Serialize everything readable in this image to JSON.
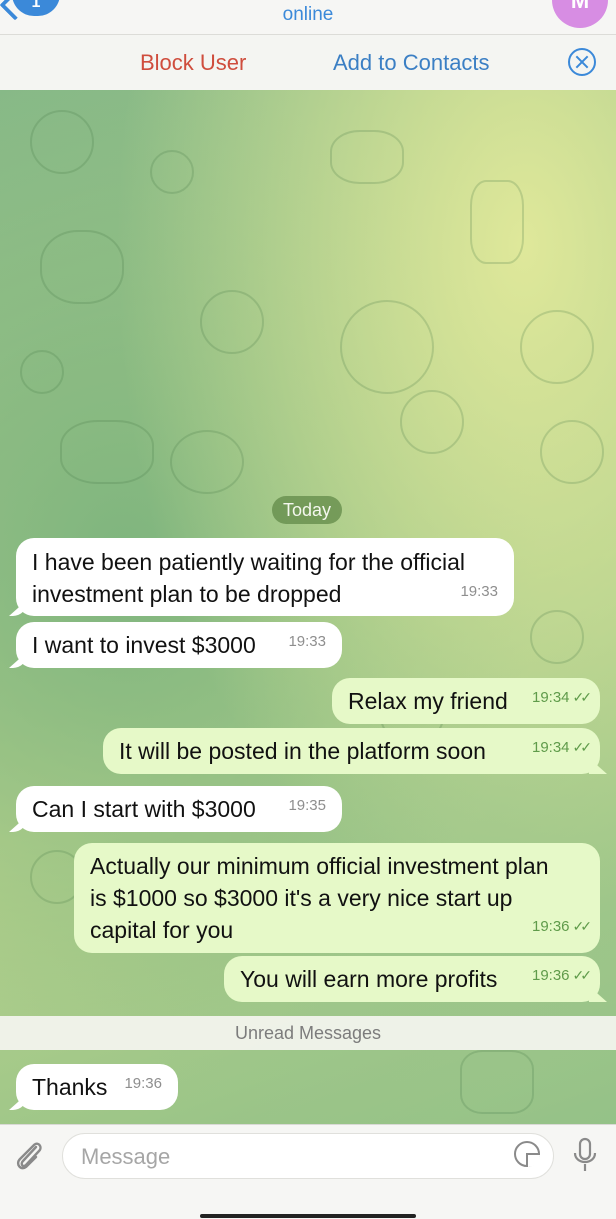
{
  "header": {
    "back_badge_count": "1",
    "status": "online",
    "avatar_initial": "M"
  },
  "action_bar": {
    "block_user": "Block User",
    "add_to_contacts": "Add to Contacts"
  },
  "chat": {
    "date_separator": "Today",
    "unread_label": "Unread Messages",
    "messages": [
      {
        "direction": "incoming",
        "text": "I have been patiently waiting for the official investment plan to be dropped",
        "time": "19:33"
      },
      {
        "direction": "incoming",
        "text": "I want to invest $3000",
        "time": "19:33"
      },
      {
        "direction": "outgoing",
        "text": "Relax my friend",
        "time": "19:34",
        "ticks": "✓✓"
      },
      {
        "direction": "outgoing",
        "text": "It will be posted in the platform soon",
        "time": "19:34",
        "ticks": "✓✓"
      },
      {
        "direction": "incoming",
        "text": "Can I start with $3000",
        "time": "19:35"
      },
      {
        "direction": "outgoing",
        "text": "Actually our minimum official investment plan is $1000 so $3000 it's a very nice start up capital for you",
        "time": "19:36",
        "ticks": "✓✓"
      },
      {
        "direction": "outgoing",
        "text": "You will earn more profits",
        "time": "19:36",
        "ticks": "✓✓"
      },
      {
        "direction": "incoming",
        "text": "Thanks",
        "time": "19:36"
      }
    ]
  },
  "input": {
    "placeholder": "Message"
  },
  "icons": {
    "back": "chevron-left-icon",
    "close": "close-circle-icon",
    "attach": "paperclip-icon",
    "sticker": "sticker-icon",
    "mic": "microphone-icon"
  },
  "colors": {
    "accent": "#3b89d9",
    "block": "#cf4d3d",
    "incoming_bubble": "#ffffff",
    "outgoing_bubble": "#e6f9c8"
  }
}
